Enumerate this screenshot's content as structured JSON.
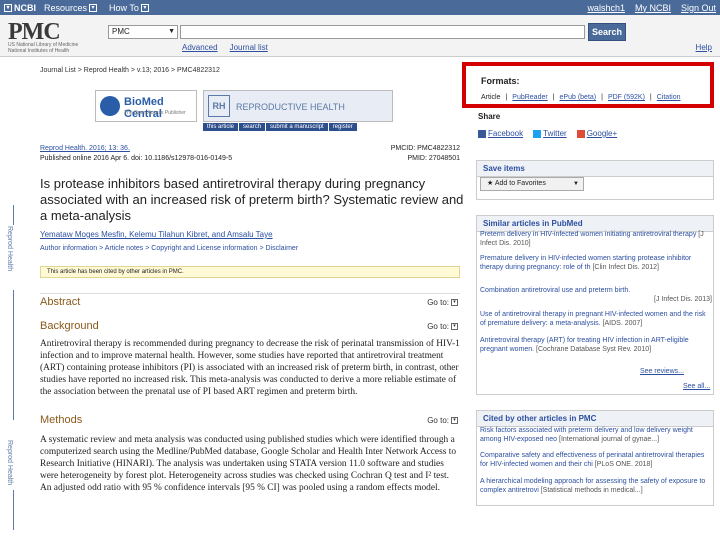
{
  "ncbi_bar": {
    "logo": "NCBI",
    "resources": "Resources",
    "howto": "How To",
    "user": "walshch1",
    "mycbi": "My NCBI",
    "signout": "Sign Out"
  },
  "header": {
    "logo": "PMC",
    "subtitle": "US National Library of Medicine National Institutes of Health",
    "db_value": "PMC",
    "search_value": "",
    "search_button": "Search",
    "advanced": "Advanced",
    "journal_list": "Journal list",
    "help": "Help"
  },
  "breadcrumb": "Journal List > Reprod Health > v.13; 2016 > PMC4822312",
  "banner": {
    "bmc_title": "BioMed Central",
    "bmc_sub": "The Open Access Publisher",
    "rh_logo": "RH",
    "rh_title": "REPRODUCTIVE HEALTH",
    "tabs": [
      "this article",
      "search",
      "submit a manuscript",
      "register"
    ]
  },
  "article": {
    "journal_cite": "Reprod Health. 2016; 13: 36.",
    "pmcid": "PMCID: PMC4822312",
    "published": "Published online 2016 Apr 6. doi: 10.1186/s12978-016-0149-5",
    "pmid": "PMID: 27048501",
    "title": "Is protease inhibitors based antiretroviral therapy during pregnancy associated with an increased risk of preterm birth? Systematic review and a meta-analysis",
    "authors": "Yemataw Moges Mesfin, Kelemu Tilahun Kibret, and Amsalu Taye",
    "author_info": "Author information > Article notes > Copyright and License information > Disclaimer",
    "notice": "This article has been cited by other articles in PMC."
  },
  "sections": {
    "abstract": "Abstract",
    "background": "Background",
    "methods": "Methods",
    "goto": "Go to:",
    "background_text": "Antiretroviral therapy is recommended during pregnancy to decrease the risk of perinatal transmission of HIV-1 infection and to improve maternal health. However, some studies have reported that antiretroviral treatment (ART) containing protease inhibitors (PI) is associated with an increased risk of preterm birth, in contrast, other studies have reported no increased risk. This meta-analysis was conducted to derive a more reliable estimate of the association between the prenatal use of PI based ART regimen and preterm birth.",
    "methods_text": "A systematic review and meta analysis was conducted using published studies which were identified through a computerized search using the Medline/PubMed database, Google Scholar and Health Inter Network Access to Research Initiative (HINARI). The analysis was undertaken using STATA version 11.0 software and studies were heterogeneity by forest plot. Heterogeneity across studies was checked using Cochran Q test and I² test. An adjusted odd ratio with 95 % confidence intervals [95 % CI] was pooled using a random effects model."
  },
  "side_label": "Reprod Health",
  "right": {
    "formats_title": "Formats:",
    "formats": [
      "Article",
      "PubReader",
      "ePub (beta)",
      "PDF (592K)",
      "Citation"
    ],
    "share": "Share",
    "social": [
      "Facebook",
      "Twitter",
      "Google+"
    ],
    "save_title": "Save items",
    "fav": "Add to Favorites",
    "similar_title": "Similar articles in PubMed",
    "similar": [
      {
        "text": "Preterm delivery in HIV-infected women initiating antiretroviral therapy",
        "src": "[J Infect Dis. 2010]"
      },
      {
        "text": "Premature delivery in HIV-infected women starting protease inhibitor therapy during pregnancy: role of th",
        "src": "[Clin Infect Dis. 2012]"
      },
      {
        "text": "Combination antiretroviral use and preterm birth.",
        "src": "[J Infect Dis. 2013]"
      },
      {
        "text": "Use of antiretroviral therapy in pregnant HIV-infected women and the risk of premature delivery: a meta-analysis.",
        "src": "[AIDS. 2007]"
      },
      {
        "text": "Antiretroviral therapy (ART) for treating HIV infection in ART-eligible pregnant women.",
        "src": "[Cochrane Database Syst Rev. 2010]"
      }
    ],
    "see_reviews": "See reviews...",
    "see_all": "See all...",
    "cited_title": "Cited by other articles in PMC",
    "cited": [
      {
        "text": "Risk factors associated with preterm delivery and low delivery weight among HIV-exposed neo",
        "src": "[International journal of gynae...]"
      },
      {
        "text": "Comparative safety and effectiveness of perinatal antiretroviral therapies for HIV-infected women and their chi",
        "src": "[PLoS ONE. 2018]"
      },
      {
        "text": "A hierarchical modeling approach for assessing the safety of exposure to complex antiretrovi",
        "src": "[Statistical methods in medical...]"
      }
    ]
  },
  "colors": {
    "ncbi_bar": "#4a6b9a",
    "formats_border": "#d40000",
    "section_heading": "#8a5a1a",
    "link": "#2c4fa0"
  }
}
